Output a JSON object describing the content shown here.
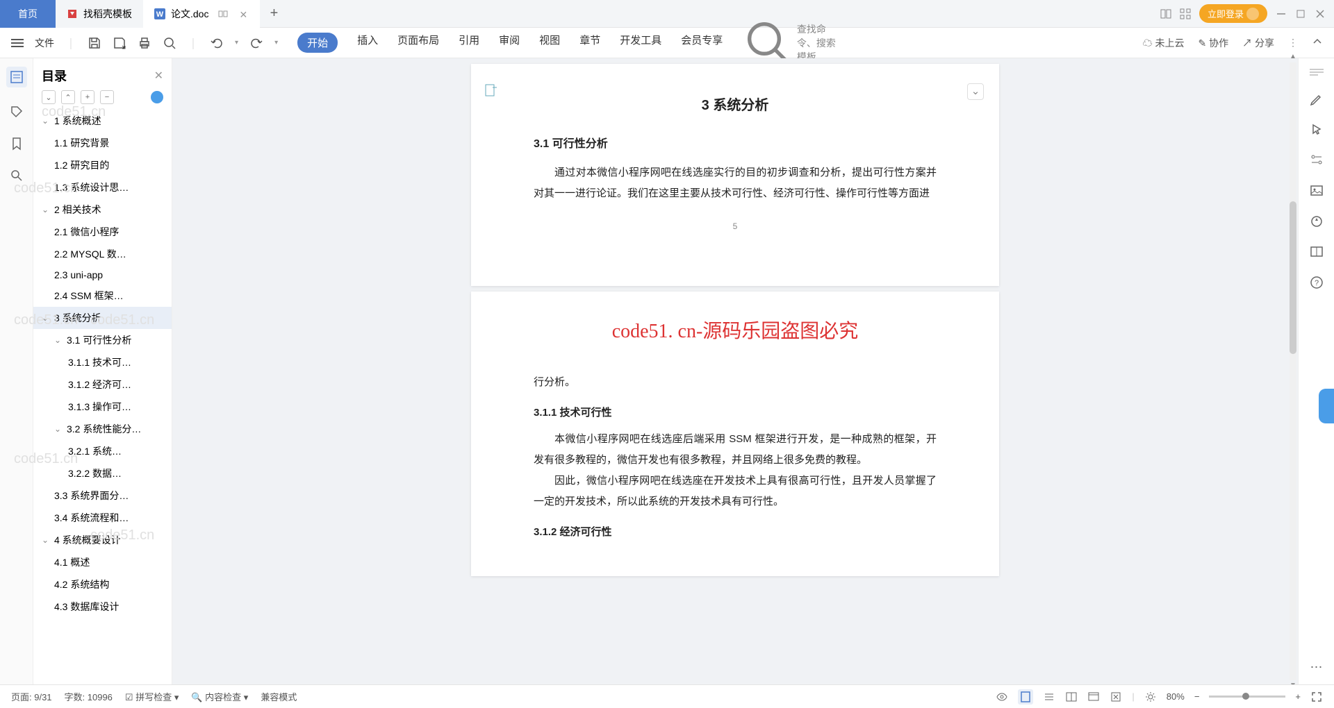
{
  "tabs": {
    "home": "首页",
    "t1": "找稻壳模板",
    "t2": "论文.doc"
  },
  "titlebar": {
    "login": "立即登录"
  },
  "ribbon": {
    "file": "文件",
    "tabs": [
      "开始",
      "插入",
      "页面布局",
      "引用",
      "审阅",
      "视图",
      "章节",
      "开发工具",
      "会员专享"
    ],
    "search": "查找命令、搜索模板",
    "cloud": "未上云",
    "coop": "协作",
    "share": "分享"
  },
  "outline": {
    "title": "目录",
    "items": [
      {
        "l": 0,
        "t": "1 系统概述",
        "c": 1
      },
      {
        "l": 1,
        "t": "1.1 研究背景"
      },
      {
        "l": 1,
        "t": "1.2 研究目的"
      },
      {
        "l": 1,
        "t": "1.3 系统设计思…"
      },
      {
        "l": 0,
        "t": "2 相关技术",
        "c": 1
      },
      {
        "l": 1,
        "t": "2.1 微信小程序"
      },
      {
        "l": 1,
        "t": "2.2 MYSQL 数…"
      },
      {
        "l": 1,
        "t": "2.3 uni-app"
      },
      {
        "l": 1,
        "t": "2.4 SSM 框架…"
      },
      {
        "l": 0,
        "t": "3 系统分析",
        "c": 1,
        "sel": 1
      },
      {
        "l": 1,
        "t": "3.1 可行性分析",
        "c": 1
      },
      {
        "l": 2,
        "t": "3.1.1 技术可…"
      },
      {
        "l": 2,
        "t": "3.1.2 经济可…"
      },
      {
        "l": 2,
        "t": "3.1.3 操作可…"
      },
      {
        "l": 1,
        "t": "3.2 系统性能分…",
        "c": 1
      },
      {
        "l": 2,
        "t": "3.2.1  系统…"
      },
      {
        "l": 2,
        "t": "3.2.2 数据…"
      },
      {
        "l": 1,
        "t": "3.3 系统界面分…"
      },
      {
        "l": 1,
        "t": "3.4 系统流程和…"
      },
      {
        "l": 0,
        "t": "4 系统概要设计",
        "c": 1
      },
      {
        "l": 1,
        "t": "4.1 概述"
      },
      {
        "l": 1,
        "t": "4.2 系统结构"
      },
      {
        "l": 1,
        "t": "4.3 数据库设计"
      }
    ]
  },
  "doc": {
    "p1_h2": "3 系统分析",
    "p1_h3": "3.1 可行性分析",
    "p1_para": "通过对本微信小程序网吧在线选座实行的目的初步调查和分析，提出可行性方案并对其一一进行论证。我们在这里主要从技术可行性、经济可行性、操作可行性等方面进",
    "p1_num": "5",
    "red": "code51. cn-源码乐园盗图必究",
    "p2_l1": "行分析。",
    "p2_h4a": "3.1.1 技术可行性",
    "p2_para1": "本微信小程序网吧在线选座后端采用 SSM 框架进行开发，是一种成熟的框架，开发有很多教程的，微信开发也有很多教程，并且网络上很多免费的教程。",
    "p2_para2": "因此，微信小程序网吧在线选座在开发技术上具有很高可行性，且开发人员掌握了一定的开发技术，所以此系统的开发技术具有可行性。",
    "p2_h4b": "3.1.2 经济可行性"
  },
  "status": {
    "page": "页面: 9/31",
    "words": "字数: 10996",
    "spell": "拼写检查",
    "inspect": "内容检查",
    "compat": "兼容模式",
    "zoom": "80%"
  },
  "wm": "code51.cn"
}
